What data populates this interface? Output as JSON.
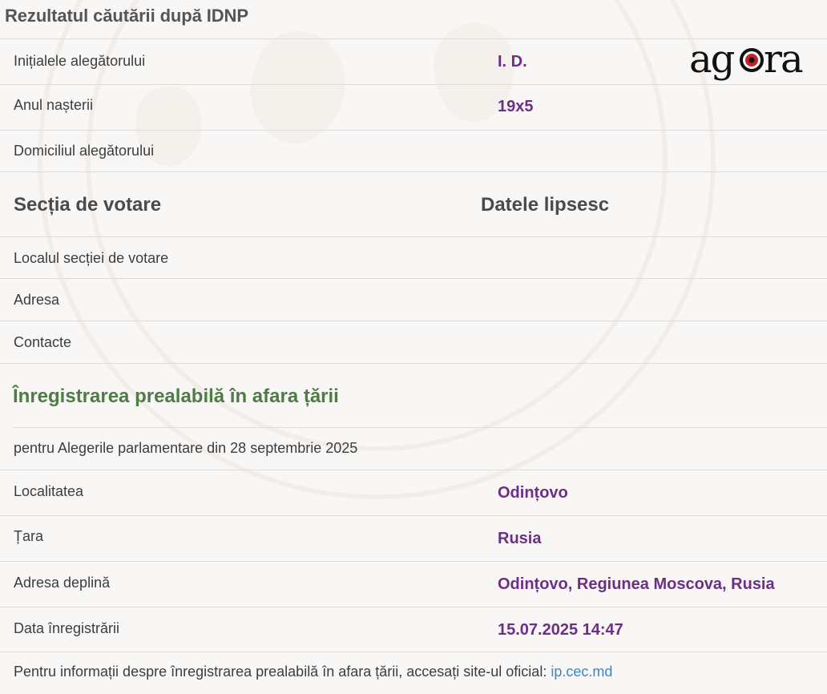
{
  "page_title": "Rezultatul căutării după IDNP",
  "logo_text": "agora",
  "voter": {
    "initials_label": "Inițialele alegătorului",
    "initials_value": "I. D.",
    "birth_year_label": "Anul nașterii",
    "birth_year_value": "19x5",
    "domicile_label": "Domiciliul alegătorului"
  },
  "polling_station": {
    "heading": "Secția de votare",
    "status": "Datele lipsesc",
    "location_label": "Localul secției de votare",
    "address_label": "Adresa",
    "contacts_label": "Contacte"
  },
  "pre_registration": {
    "heading": "Înregistrarea prealabilă în afara țării",
    "election": "pentru Alegerile parlamentare din 28 septembrie 2025",
    "locality_label": "Localitatea",
    "locality_value": "Odințovo",
    "country_label": "Țara",
    "country_value": "Rusia",
    "full_address_label": "Adresa deplină",
    "full_address_value": "Odințovo, Regiunea Moscova, Rusia",
    "reg_date_label": "Data înregistrării",
    "reg_date_value": "15.07.2025 14:47"
  },
  "footer": {
    "text": "Pentru informații despre înregistrarea prealabilă în afara țării, accesați site-ul oficial: ",
    "link_text": "ip.cec.md"
  },
  "colors": {
    "value_purple": "#6b2f86",
    "heading_green": "#4f7c45",
    "link_blue": "#3c87c4",
    "background": "#f8f7f6"
  }
}
